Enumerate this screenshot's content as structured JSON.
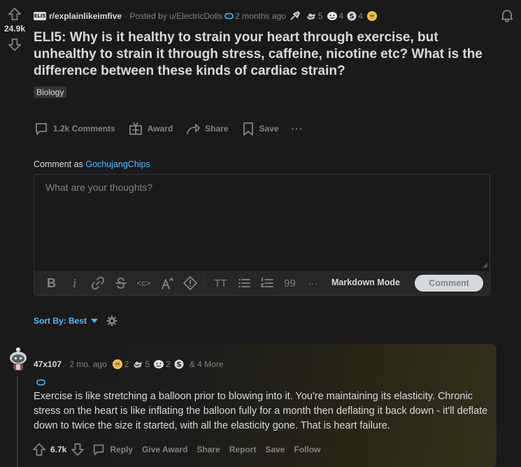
{
  "post": {
    "subreddit_icon_text": "ELI5",
    "subreddit": "r/explainlikeimfive",
    "posted_by_prefix": "· Posted by",
    "author": "u/ElectricDolls",
    "time": "2 months ago",
    "awards": [
      {
        "icon": "rocket-award-icon",
        "count": ""
      },
      {
        "icon": "helpful-award-icon",
        "count": "5"
      },
      {
        "icon": "wholesome-award-icon",
        "count": "4"
      },
      {
        "icon": "silver-award-icon",
        "count": "4"
      },
      {
        "icon": "gold-award-icon",
        "count": ""
      }
    ],
    "vote_count": "24.9k",
    "title": "ELI5: Why is it healthy to strain your heart through exercise, but unhealthy to strain it through stress, caffeine, nicotine etc? What is the difference between these kinds of cardiac strain?",
    "flair": "Biology",
    "actions": {
      "comments": "1.2k Comments",
      "award": "Award",
      "share": "Share",
      "save": "Save",
      "more": "···"
    }
  },
  "composer": {
    "comment_as_label": "Comment as",
    "username": "GochujangChips",
    "placeholder": "What are your thoughts?",
    "toolbar": {
      "bold": "B",
      "italic": "i",
      "code": "<c>",
      "spoiler": "!",
      "heading": "TT",
      "quote": "99",
      "more": "···"
    },
    "markdown_mode": "Markdown Mode",
    "submit_label": "Comment"
  },
  "sort": {
    "label": "Sort By: Best"
  },
  "comment": {
    "author": "47x107",
    "time": "· 2 mo. ago",
    "awards": [
      {
        "icon": "gold-award-icon",
        "count": "2"
      },
      {
        "icon": "helpful-award-icon",
        "count": "5"
      },
      {
        "icon": "wholesome-award-icon",
        "count": "2"
      },
      {
        "icon": "silver-award-icon",
        "count": ""
      }
    ],
    "more_awards": "& 4 More",
    "body": "Exercise is like stretching a balloon prior to blowing into it. You're maintaining its elasticity. Chronic stress on the heart is like inflating the balloon fully for a month then deflating it back down - it'll deflate down to twice the size it started, with all the elasticity gone. That is heart failure.",
    "vote_count": "6.7k",
    "actions": {
      "reply": "Reply",
      "give_award": "Give Award",
      "share": "Share",
      "report": "Report",
      "save": "Save",
      "follow": "Follow"
    }
  },
  "colors": {
    "background": "#1a1a1b",
    "text": "#d7dadc",
    "muted": "#818384",
    "link": "#4fbcff",
    "border": "#343536"
  }
}
